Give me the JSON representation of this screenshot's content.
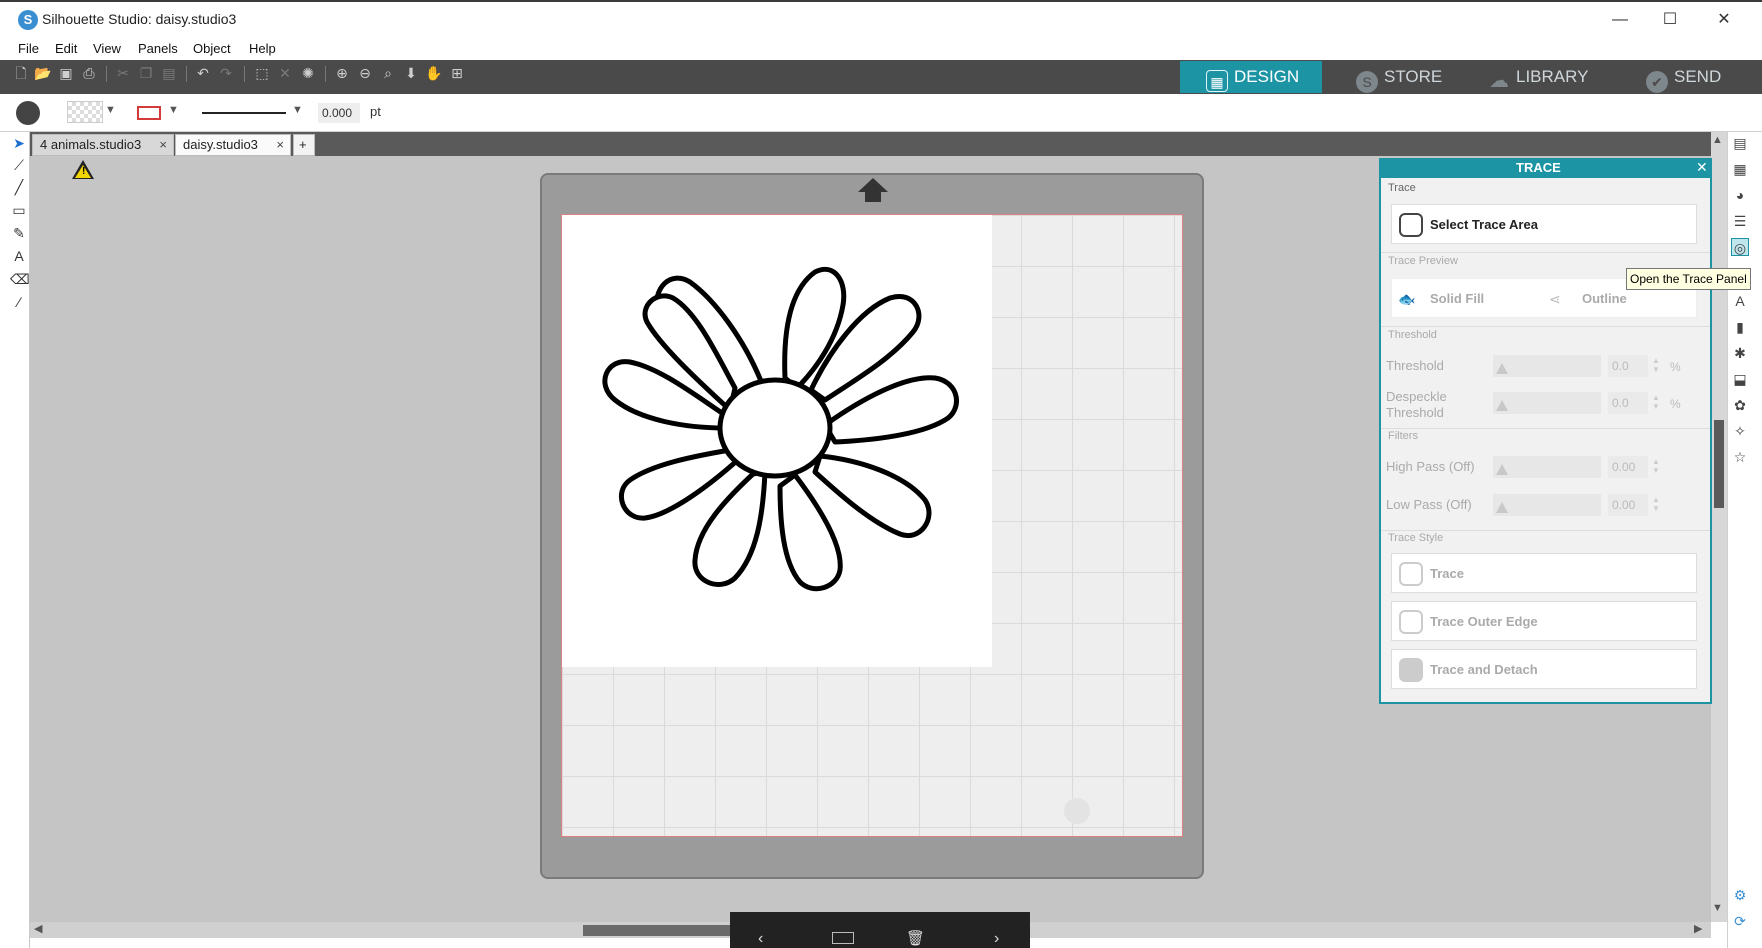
{
  "window": {
    "title": "Silhouette Studio: daisy.studio3",
    "min_glyph": "—",
    "max_glyph": "☐",
    "close_glyph": "✕"
  },
  "menu": [
    "File",
    "Edit",
    "View",
    "Panels",
    "Object",
    "Help"
  ],
  "nav_tabs": [
    {
      "label": "DESIGN",
      "icon": "grid-icon",
      "active": true
    },
    {
      "label": "STORE",
      "icon": "silhouette-s-icon",
      "active": false
    },
    {
      "label": "LIBRARY",
      "icon": "cloud-icon",
      "active": false
    },
    {
      "label": "SEND",
      "icon": "check-circle-icon",
      "active": false
    }
  ],
  "options": {
    "line_weight_value": "0.000",
    "line_weight_unit": "pt"
  },
  "doc_tabs": [
    {
      "label": "4 animals.studio3"
    },
    {
      "label": "daisy.studio3"
    }
  ],
  "add_tab_glyph": "+",
  "trace_panel": {
    "title": "TRACE",
    "section_trace": "Trace",
    "select_trace_area": "Select Trace Area",
    "section_preview": "Trace Preview",
    "solid_fill": "Solid Fill",
    "outline": "Outline",
    "section_threshold": "Threshold",
    "threshold_label": "Threshold",
    "threshold_value": "0.0",
    "despeckle_label_1": "Despeckle",
    "despeckle_label_2": "Threshold",
    "despeckle_value": "0.0",
    "percent": "%",
    "section_filters": "Filters",
    "high_pass_label": "High Pass (Off)",
    "high_pass_value": "0.00",
    "low_pass_label": "Low Pass (Off)",
    "low_pass_value": "0.00",
    "section_style": "Trace Style",
    "style_trace": "Trace",
    "style_outer": "Trace Outer Edge",
    "style_detach": "Trace and Detach"
  },
  "tooltip": "Open the Trace Panel",
  "colors": {
    "accent": "#1d94a4",
    "nav_active": "#1d94a4",
    "toolbar": "#4a4a4a",
    "canvas": "#c5c5c5"
  }
}
